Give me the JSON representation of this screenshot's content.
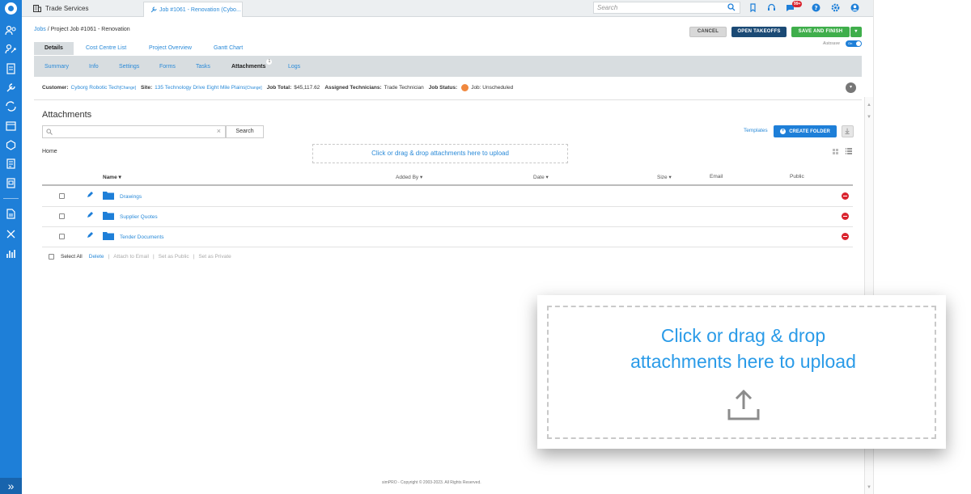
{
  "topbar": {
    "tab_company": "Trade Services",
    "tab_job": "Job #1061 - Renovation (Cybo...",
    "search_placeholder": "Search",
    "notification_count": "99+"
  },
  "breadcrumb": {
    "root": "Jobs",
    "sep": " / ",
    "current": "Project Job #1061 - Renovation"
  },
  "actions": {
    "cancel": "CANCEL",
    "open_takeoffs": "OPEN TAKEOFFS",
    "save_finish": "SAVE AND FINISH",
    "autosave_label": "Autosave",
    "autosave_state": "On"
  },
  "main_tabs": [
    "Details",
    "Cost Centre List",
    "Project Overview",
    "Gantt Chart"
  ],
  "sub_tabs": [
    "Summary",
    "Info",
    "Settings",
    "Forms",
    "Tasks",
    "Attachments",
    "Logs"
  ],
  "attachments_count": "1",
  "info": {
    "customer_label": "Customer:",
    "customer": "Cyborg Robotic Tech",
    "change": "[Change]",
    "site_label": "Site:",
    "site": "135 Technology Drive Eight Mile Plains",
    "job_total_label": "Job Total:",
    "job_total": "$45,117.62",
    "technicians_label": "Assigned Technicians:",
    "technicians": "Trade Technician",
    "status_label": "Job Status:",
    "status": "Job: Unscheduled"
  },
  "attachments": {
    "title": "Attachments",
    "search_button": "Search",
    "templates": "Templates",
    "create_folder": "CREATE FOLDER",
    "home": "Home",
    "drop_text": "Click or drag & drop attachments here to upload",
    "columns": [
      "Name ▾",
      "Added By ▾",
      "Date ▾",
      "Size ▾",
      "Email",
      "Public"
    ],
    "rows": [
      {
        "name": "Drawings"
      },
      {
        "name": "Supplier Quotes"
      },
      {
        "name": "Tender Documents"
      }
    ],
    "select_all": "Select All",
    "bulk_actions": [
      "Delete",
      "Attach to Email",
      "Set as Public",
      "Set as Private"
    ]
  },
  "footer": {
    "copyright": "simPRO - Copyright © 2003-2023. All Rights Reserved."
  },
  "callout": {
    "line1": "Click or drag & drop",
    "line2": "attachments here to upload"
  }
}
